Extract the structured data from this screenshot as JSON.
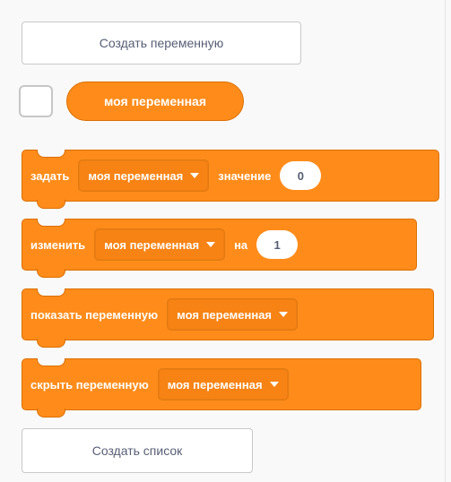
{
  "palette": {
    "create_variable_label": "Создать переменную",
    "create_list_label": "Создать список",
    "reporter_label": "моя переменная"
  },
  "blocks": {
    "set": {
      "verb": "задать",
      "var": "моя переменная",
      "to_label": "значение",
      "value": "0"
    },
    "change": {
      "verb": "изменить",
      "var": "моя переменная",
      "by_label": "на",
      "value": "1"
    },
    "show": {
      "verb": "показать переменную",
      "var": "моя переменная"
    },
    "hide": {
      "verb": "скрыть переменную",
      "var": "моя переменная"
    }
  },
  "colors": {
    "variables_block": "#ff8c1a",
    "variables_border": "#db6e00",
    "button_text": "#575e75"
  },
  "icons": {
    "dropdown": "caret-down-icon"
  }
}
